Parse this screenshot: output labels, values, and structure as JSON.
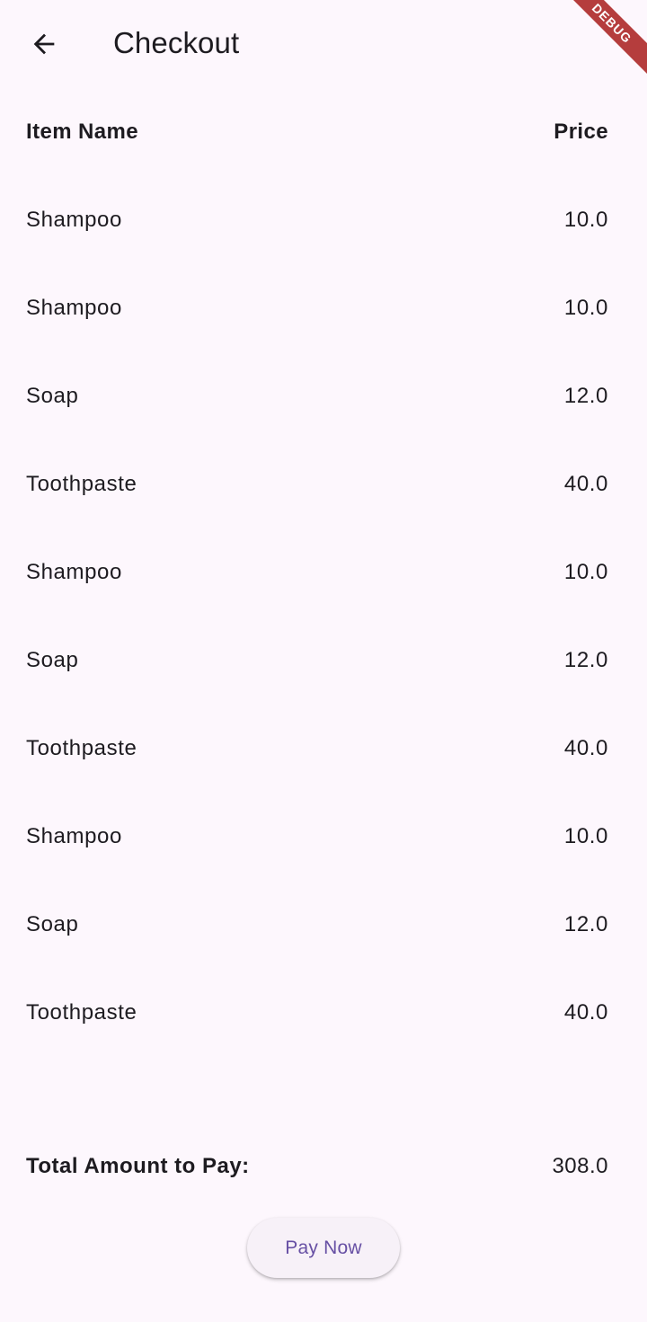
{
  "appbar": {
    "title": "Checkout",
    "back_icon": "arrow-back-icon"
  },
  "debug_banner": "DEBUG",
  "table": {
    "headers": {
      "item": "Item Name",
      "price": "Price"
    },
    "rows": [
      {
        "name": "Shampoo",
        "price": "10.0"
      },
      {
        "name": "Shampoo",
        "price": "10.0"
      },
      {
        "name": "Soap",
        "price": "12.0"
      },
      {
        "name": "Toothpaste",
        "price": "40.0"
      },
      {
        "name": "Shampoo",
        "price": "10.0"
      },
      {
        "name": "Soap",
        "price": "12.0"
      },
      {
        "name": "Toothpaste",
        "price": "40.0"
      },
      {
        "name": "Shampoo",
        "price": "10.0"
      },
      {
        "name": "Soap",
        "price": "12.0"
      },
      {
        "name": "Toothpaste",
        "price": "40.0"
      }
    ]
  },
  "total": {
    "label": "Total Amount to Pay:",
    "value": "308.0"
  },
  "pay_button": {
    "label": "Pay Now"
  },
  "colors": {
    "background": "#fdf7fd",
    "text": "#1d1b20",
    "accent": "#6750a4",
    "debug_banner": "#b53d3d"
  }
}
